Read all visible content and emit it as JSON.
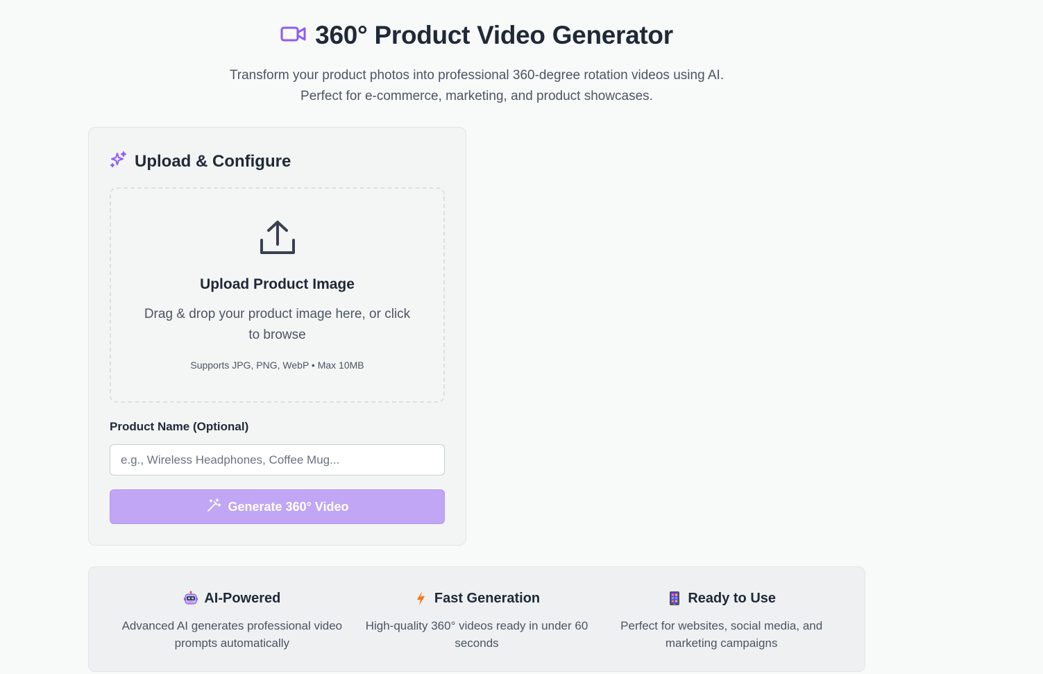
{
  "header": {
    "title": "360° Product Video Generator",
    "subtitle_line1": "Transform your product photos into professional 360-degree rotation videos using AI.",
    "subtitle_line2": "Perfect for e-commerce, marketing, and product showcases.",
    "icon": "video-camera-icon"
  },
  "upload_card": {
    "title": "Upload & Configure",
    "title_icon": "sparkles-icon",
    "dropzone": {
      "icon": "upload-icon",
      "title": "Upload Product Image",
      "description": "Drag & drop your product image here, or click to browse",
      "support": "Supports JPG, PNG, WebP • Max 10MB"
    },
    "product_name_label": "Product Name (Optional)",
    "product_name_value": "",
    "product_name_placeholder": "e.g., Wireless Headphones, Coffee Mug...",
    "generate_label": "Generate 360° Video",
    "generate_icon": "magic-wand-icon"
  },
  "features": [
    {
      "icon": "robot-icon",
      "title": "AI-Powered",
      "description": "Advanced AI generates professional video prompts automatically"
    },
    {
      "icon": "lightning-icon",
      "title": "Fast Generation",
      "description": "High-quality 360° videos ready in under 60 seconds"
    },
    {
      "icon": "mobile-phone-icon",
      "title": "Ready to Use",
      "description": "Perfect for websites, social media, and marketing campaigns"
    }
  ],
  "colors": {
    "accent": "#8b5cf6",
    "button_disabled": "#c0a6f4",
    "background": "#f8f9f9",
    "card": "#f3f4f4"
  }
}
